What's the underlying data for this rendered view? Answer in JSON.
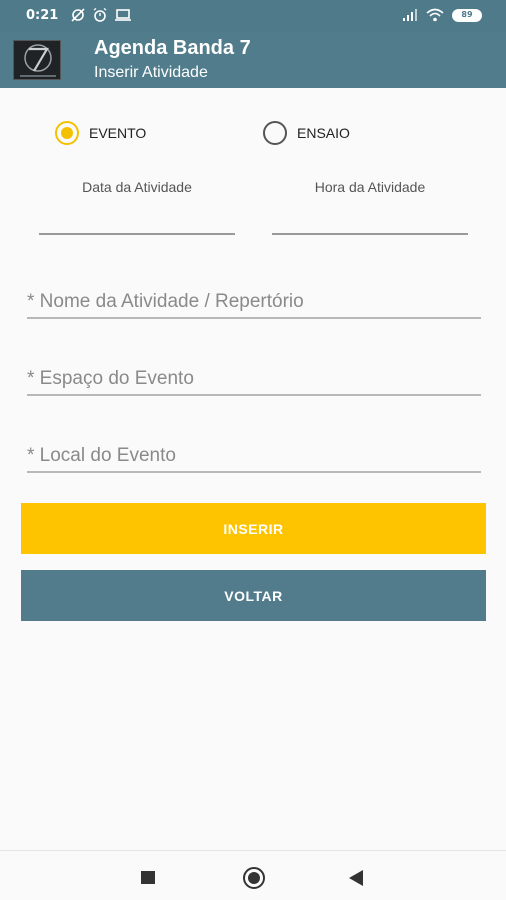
{
  "status_bar": {
    "time": "0:21",
    "battery": "89",
    "icons": [
      "sync-off-icon",
      "alarm-icon",
      "laptop-icon",
      "signal-icon",
      "wifi-icon",
      "battery-icon"
    ]
  },
  "app_bar": {
    "title": "Agenda Banda 7",
    "subtitle": "Inserir Atividade"
  },
  "activity_type": {
    "options": [
      {
        "label": "EVENTO",
        "checked": true
      },
      {
        "label": "ENSAIO",
        "checked": false
      }
    ]
  },
  "date_label": "Data da Atividade",
  "time_label": "Hora da Atividade",
  "fields": {
    "name_placeholder": "* Nome da Atividade / Repertório",
    "space_placeholder": "* Espaço do Evento",
    "location_placeholder": "* Local do Evento"
  },
  "buttons": {
    "insert": "INSERIR",
    "back": "VOLTAR"
  },
  "colors": {
    "primary": "#507c8c",
    "accent": "#ffc400"
  }
}
